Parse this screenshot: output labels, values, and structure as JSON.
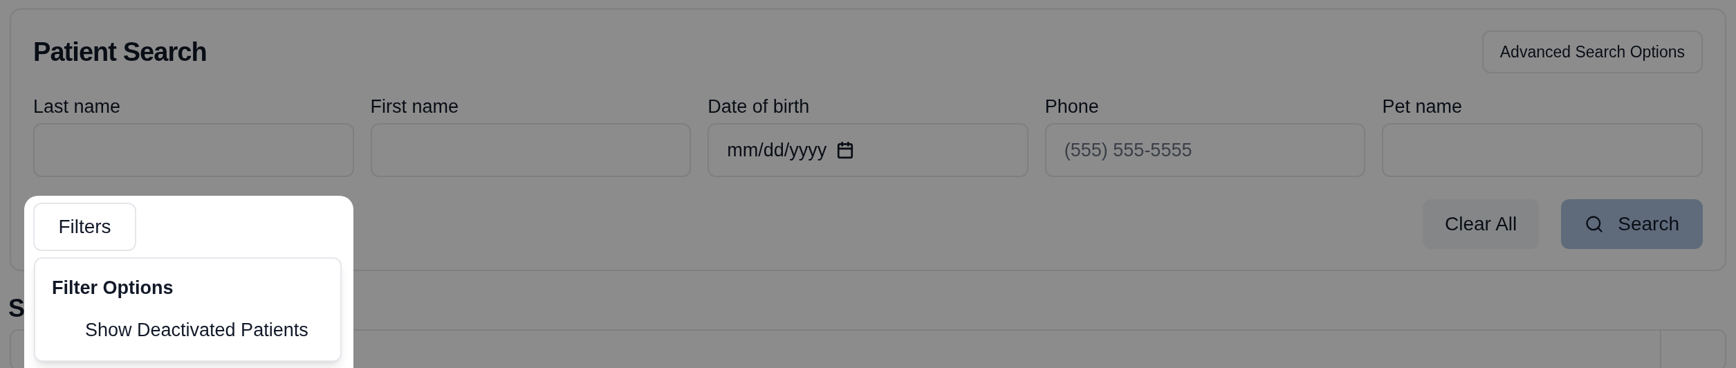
{
  "search_panel": {
    "title": "Patient Search",
    "advanced_button": "Advanced Search Options",
    "fields": [
      {
        "kind": "text",
        "label": "Last name"
      },
      {
        "kind": "text",
        "label": "First name"
      },
      {
        "kind": "date",
        "label": "Date of birth",
        "value": "mm/dd/yyyy"
      },
      {
        "kind": "text",
        "label": "Phone",
        "placeholder": "(555) 555-5555"
      },
      {
        "kind": "text",
        "label": "Pet name"
      }
    ],
    "clear_button": "Clear All",
    "search_button": "Search"
  },
  "filters": {
    "button": "Filters",
    "open": true,
    "menu": {
      "heading": "Filter Options",
      "items": [
        {
          "label": "Show Deactivated Patients",
          "checked": false
        }
      ]
    }
  },
  "results": {
    "heading": "S"
  }
}
